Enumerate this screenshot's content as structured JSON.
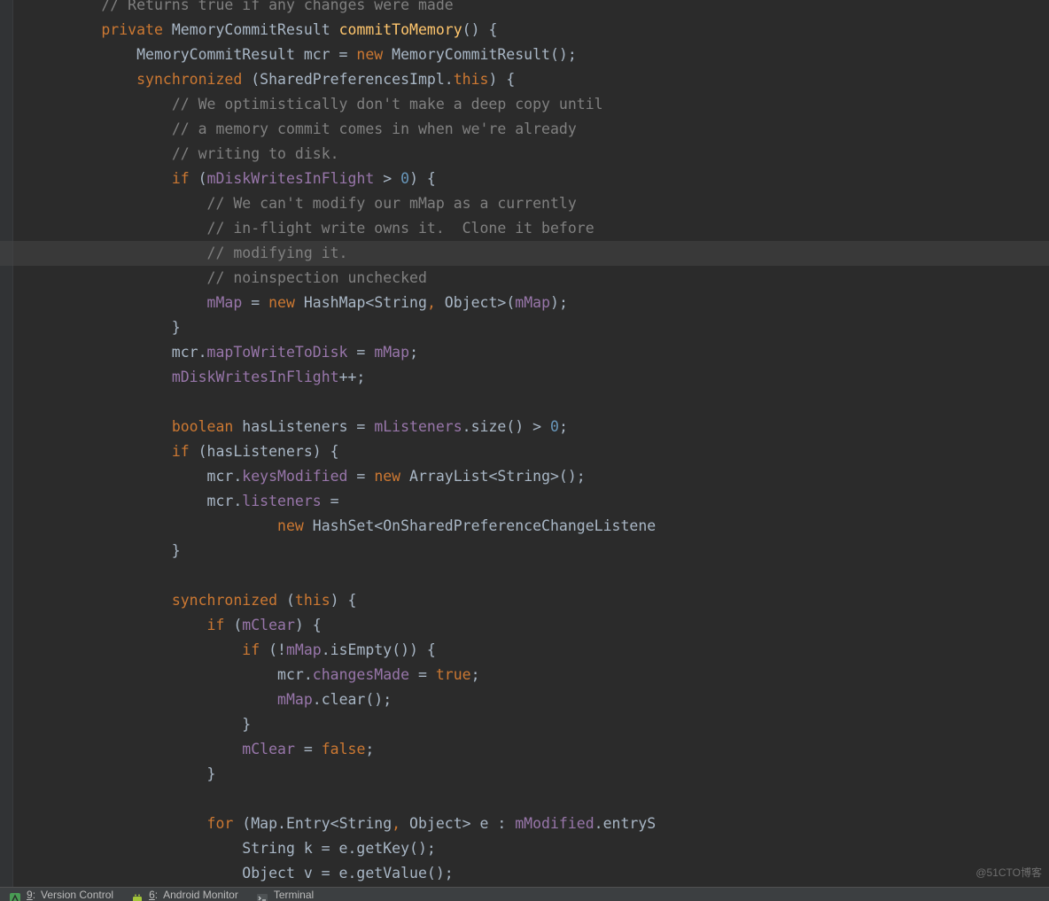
{
  "code": {
    "tokens": [
      [
        [
          "comment",
          "          // Returns true if any changes were made"
        ]
      ],
      [
        [
          "text",
          "          "
        ],
        [
          "kw",
          "private"
        ],
        [
          "text",
          " MemoryCommitResult "
        ],
        [
          "methoddef",
          "commitToMemory"
        ],
        [
          "text",
          "() {"
        ]
      ],
      [
        [
          "text",
          "              MemoryCommitResult mcr = "
        ],
        [
          "kw",
          "new"
        ],
        [
          "text",
          " MemoryCommitResult();"
        ]
      ],
      [
        [
          "text",
          "              "
        ],
        [
          "kw",
          "synchronized"
        ],
        [
          "text",
          " (SharedPreferencesImpl."
        ],
        [
          "kw",
          "this"
        ],
        [
          "text",
          ") {"
        ]
      ],
      [
        [
          "text",
          "                  "
        ],
        [
          "comment",
          "// We optimistically don't make a deep copy until"
        ]
      ],
      [
        [
          "text",
          "                  "
        ],
        [
          "comment",
          "// a memory commit comes in when we're already"
        ]
      ],
      [
        [
          "text",
          "                  "
        ],
        [
          "comment",
          "// writing to disk."
        ]
      ],
      [
        [
          "text",
          "                  "
        ],
        [
          "kw",
          "if"
        ],
        [
          "text",
          " ("
        ],
        [
          "field",
          "mDiskWritesInFlight"
        ],
        [
          "text",
          " > "
        ],
        [
          "num",
          "0"
        ],
        [
          "text",
          ") {"
        ]
      ],
      [
        [
          "text",
          "                      "
        ],
        [
          "comment",
          "// We can't modify our mMap as a currently"
        ]
      ],
      [
        [
          "text",
          "                      "
        ],
        [
          "comment",
          "// in-flight write owns it.  Clone it before"
        ]
      ],
      [
        [
          "text",
          "                      "
        ],
        [
          "comment",
          "// modifying it."
        ]
      ],
      [
        [
          "text",
          "                      "
        ],
        [
          "comment",
          "// noinspection unchecked"
        ]
      ],
      [
        [
          "text",
          "                      "
        ],
        [
          "field",
          "mMap"
        ],
        [
          "text",
          " = "
        ],
        [
          "kw",
          "new"
        ],
        [
          "text",
          " HashMap<String"
        ],
        [
          "kw",
          ","
        ],
        [
          "text",
          " Object>("
        ],
        [
          "field",
          "mMap"
        ],
        [
          "text",
          ");"
        ]
      ],
      [
        [
          "text",
          "                  }"
        ]
      ],
      [
        [
          "text",
          "                  mcr."
        ],
        [
          "field",
          "mapToWriteToDisk"
        ],
        [
          "text",
          " = "
        ],
        [
          "field",
          "mMap"
        ],
        [
          "text",
          ";"
        ]
      ],
      [
        [
          "text",
          "                  "
        ],
        [
          "field",
          "mDiskWritesInFlight"
        ],
        [
          "text",
          "++;"
        ]
      ],
      [
        [
          "text",
          ""
        ]
      ],
      [
        [
          "text",
          "                  "
        ],
        [
          "kw",
          "boolean"
        ],
        [
          "text",
          " hasListeners = "
        ],
        [
          "field",
          "mListeners"
        ],
        [
          "text",
          ".size() > "
        ],
        [
          "num",
          "0"
        ],
        [
          "text",
          ";"
        ]
      ],
      [
        [
          "text",
          "                  "
        ],
        [
          "kw",
          "if"
        ],
        [
          "text",
          " (hasListeners) {"
        ]
      ],
      [
        [
          "text",
          "                      mcr."
        ],
        [
          "field",
          "keysModified"
        ],
        [
          "text",
          " = "
        ],
        [
          "kw",
          "new"
        ],
        [
          "text",
          " ArrayList<String>();"
        ]
      ],
      [
        [
          "text",
          "                      mcr."
        ],
        [
          "field",
          "listeners"
        ],
        [
          "text",
          " ="
        ]
      ],
      [
        [
          "text",
          "                              "
        ],
        [
          "kw",
          "new"
        ],
        [
          "text",
          " HashSet<OnSharedPreferenceChangeListene"
        ]
      ],
      [
        [
          "text",
          "                  }"
        ]
      ],
      [
        [
          "text",
          ""
        ]
      ],
      [
        [
          "text",
          "                  "
        ],
        [
          "kw",
          "synchronized"
        ],
        [
          "text",
          " ("
        ],
        [
          "kw",
          "this"
        ],
        [
          "text",
          ") {"
        ]
      ],
      [
        [
          "text",
          "                      "
        ],
        [
          "kw",
          "if"
        ],
        [
          "text",
          " ("
        ],
        [
          "field",
          "mClear"
        ],
        [
          "text",
          ") {"
        ]
      ],
      [
        [
          "text",
          "                          "
        ],
        [
          "kw",
          "if"
        ],
        [
          "text",
          " (!"
        ],
        [
          "field",
          "mMap"
        ],
        [
          "text",
          ".isEmpty()) {"
        ]
      ],
      [
        [
          "text",
          "                              mcr."
        ],
        [
          "field",
          "changesMade"
        ],
        [
          "text",
          " = "
        ],
        [
          "kw",
          "true"
        ],
        [
          "text",
          ";"
        ]
      ],
      [
        [
          "text",
          "                              "
        ],
        [
          "field",
          "mMap"
        ],
        [
          "text",
          ".clear();"
        ]
      ],
      [
        [
          "text",
          "                          }"
        ]
      ],
      [
        [
          "text",
          "                          "
        ],
        [
          "field",
          "mClear"
        ],
        [
          "text",
          " = "
        ],
        [
          "kw",
          "false"
        ],
        [
          "text",
          ";"
        ]
      ],
      [
        [
          "text",
          "                      }"
        ]
      ],
      [
        [
          "text",
          ""
        ]
      ],
      [
        [
          "text",
          "                      "
        ],
        [
          "kw",
          "for"
        ],
        [
          "text",
          " (Map.Entry<String"
        ],
        [
          "kw",
          ","
        ],
        [
          "text",
          " Object> e : "
        ],
        [
          "field",
          "mModified"
        ],
        [
          "text",
          ".entryS"
        ]
      ],
      [
        [
          "text",
          "                          String k = e.getKey();"
        ]
      ],
      [
        [
          "text",
          "                          Object v = e.getValue();"
        ]
      ]
    ]
  },
  "bottomBar": {
    "items": [
      {
        "index": "9",
        "label": "Version Control"
      },
      {
        "index": "6",
        "label": "Android Monitor"
      },
      {
        "index": "",
        "label": "Terminal"
      }
    ]
  },
  "watermark": "@51CTO博客"
}
